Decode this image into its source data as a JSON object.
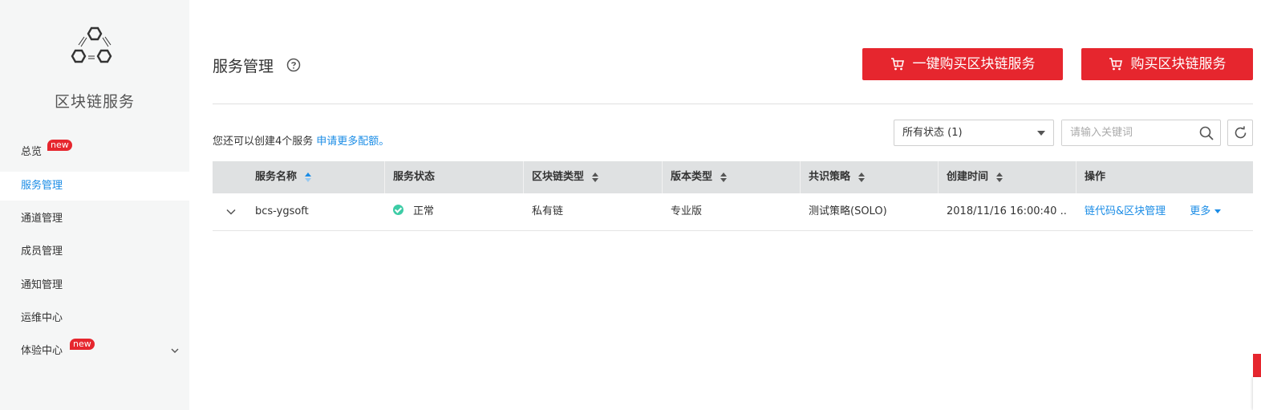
{
  "sidebar": {
    "product_name": "区块链服务",
    "logo_icon": "hexagon-network-logo",
    "items": [
      {
        "label": "总览",
        "badge": "new"
      },
      {
        "label": "服务管理",
        "active": true
      },
      {
        "label": "通道管理"
      },
      {
        "label": "成员管理"
      },
      {
        "label": "通知管理"
      },
      {
        "label": "运维中心"
      },
      {
        "label": "体验中心",
        "badge": "new",
        "expandable": true
      }
    ]
  },
  "header": {
    "title": "服务管理",
    "help_icon": "question-circle-icon",
    "buy_one_click_label": "一键购买区块链服务",
    "buy_label": "购买区块链服务",
    "cart_icon": "cart-icon"
  },
  "toolbar": {
    "quota_text": "您还可以创建4个服务",
    "quota_link": "申请更多配额。",
    "status_filter": "所有状态 (1)",
    "search_placeholder": "请输入关键词"
  },
  "table": {
    "columns": [
      "服务名称",
      "服务状态",
      "区块链类型",
      "版本类型",
      "共识策略",
      "创建时间",
      "操作"
    ],
    "rows": [
      {
        "name": "bcs-ygsoft",
        "status": "正常",
        "chain_type": "私有链",
        "edition": "专业版",
        "consensus": "测试策略(SOLO)",
        "created": "2018/11/16 16:00:40 ...",
        "action_manage": "链代码&区块管理",
        "action_more": "更多"
      }
    ]
  },
  "colors": {
    "accent": "#1a8ce6",
    "brand_red": "#e6262e",
    "status_ok": "#3dcca6"
  }
}
